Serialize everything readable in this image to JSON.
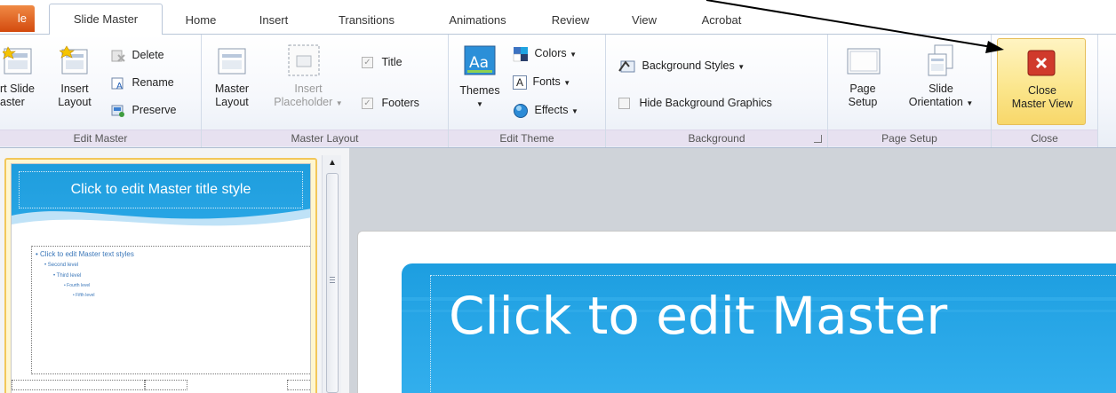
{
  "tabs": {
    "file": "le",
    "slide_master": "Slide Master",
    "home": "Home",
    "insert": "Insert",
    "transitions": "Transitions",
    "animations": "Animations",
    "review": "Review",
    "view": "View",
    "acrobat": "Acrobat"
  },
  "groups": {
    "edit_master": {
      "label": "Edit Master",
      "insert_slide_master": [
        "rt Slide",
        "aster"
      ],
      "insert_layout": [
        "Insert",
        "Layout"
      ],
      "delete": "Delete",
      "rename": "Rename",
      "preserve": "Preserve"
    },
    "master_layout": {
      "label": "Master Layout",
      "master_layout": [
        "Master",
        "Layout"
      ],
      "insert_placeholder": [
        "Insert",
        "Placeholder"
      ],
      "title": "Title",
      "footers": "Footers"
    },
    "edit_theme": {
      "label": "Edit Theme",
      "themes": "Themes",
      "colors": "Colors",
      "fonts": "Fonts",
      "effects": "Effects"
    },
    "background": {
      "label": "Background",
      "background_styles": "Background Styles",
      "hide_background_graphics": "Hide Background Graphics"
    },
    "page_setup": {
      "label": "Page Setup",
      "page_setup": [
        "Page",
        "Setup"
      ],
      "slide_orientation": [
        "Slide",
        "Orientation"
      ]
    },
    "close": {
      "label": "Close",
      "close_master_view": [
        "Close",
        "Master View"
      ]
    }
  },
  "thumbnail": {
    "title": "Click to edit Master title style",
    "levels": [
      "Click to edit Master text styles",
      "Second level",
      "Third level",
      "Fourth level",
      "Fifth level"
    ]
  },
  "main_slide": {
    "title": "Click to edit Master"
  },
  "colors": {
    "title_blue": "#1d9ee0",
    "close_highlight": "#fbe58a",
    "group_label_bg": "#e7e1f0"
  }
}
